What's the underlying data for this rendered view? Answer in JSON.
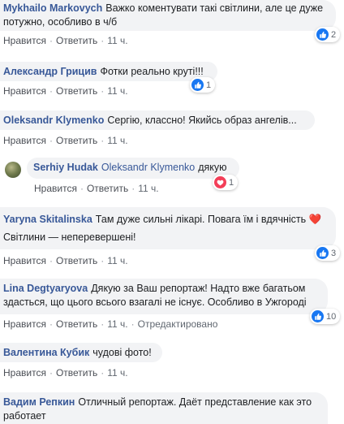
{
  "comments": [
    {
      "author": "Mykhailo Markovych",
      "text": "Важко коментувати такі світлини, але це дуже потужно, особливо в ч/б",
      "actions": {
        "like": "Нравится",
        "reply": "Ответить",
        "time": "11 ч."
      },
      "reaction": {
        "type": "like",
        "count": "2"
      }
    },
    {
      "author": "Александр Грицив",
      "text": "Фотки реально круті!!!",
      "actions": {
        "like": "Нравится",
        "reply": "Ответить",
        "time": "11 ч."
      },
      "reaction": {
        "type": "like",
        "count": "1"
      }
    },
    {
      "author": "Oleksandr Klymenko",
      "text": "Сергію, классно! Якийсь образ ангелів...",
      "actions": {
        "like": "Нравится",
        "reply": "Ответить",
        "time": "11 ч."
      }
    },
    {
      "author": "Serhiy Hudak",
      "mention": "Oleksandr Klymenko",
      "text": "дякую",
      "actions": {
        "like": "Нравится",
        "reply": "Ответить",
        "time": "11 ч."
      },
      "reaction": {
        "type": "love",
        "count": "1"
      }
    },
    {
      "author": "Yaryna Skitalinska",
      "text": "Там дуже сильні лікарі. Повага їм і вдячність",
      "emoji": "❤️",
      "text2": "Світлини — неперевершені!",
      "actions": {
        "like": "Нравится",
        "reply": "Ответить",
        "time": "11 ч."
      },
      "reaction": {
        "type": "like",
        "count": "3"
      }
    },
    {
      "author": "Lina Degtyaryova",
      "text": "Дякую за Ваш репортаж! Надто вже багатьом здасться, що цього всього взагалі не існує. Особливо в Ужгороді",
      "actions": {
        "like": "Нравится",
        "reply": "Ответить",
        "time": "11 ч.",
        "edited": "Отредактировано"
      },
      "reaction": {
        "type": "like",
        "count": "10"
      }
    },
    {
      "author": "Валентина Кубик",
      "text": "чудові фото!",
      "actions": {
        "like": "Нравится",
        "reply": "Ответить",
        "time": "11 ч."
      }
    },
    {
      "author": "Вадим Репкин",
      "text": "Отличный репортаж. Даёт представление как это работает"
    }
  ],
  "colors": {
    "author": "#385898",
    "like": "#1877f2",
    "love": "#f33e58",
    "bubble": "#f2f3f5"
  }
}
